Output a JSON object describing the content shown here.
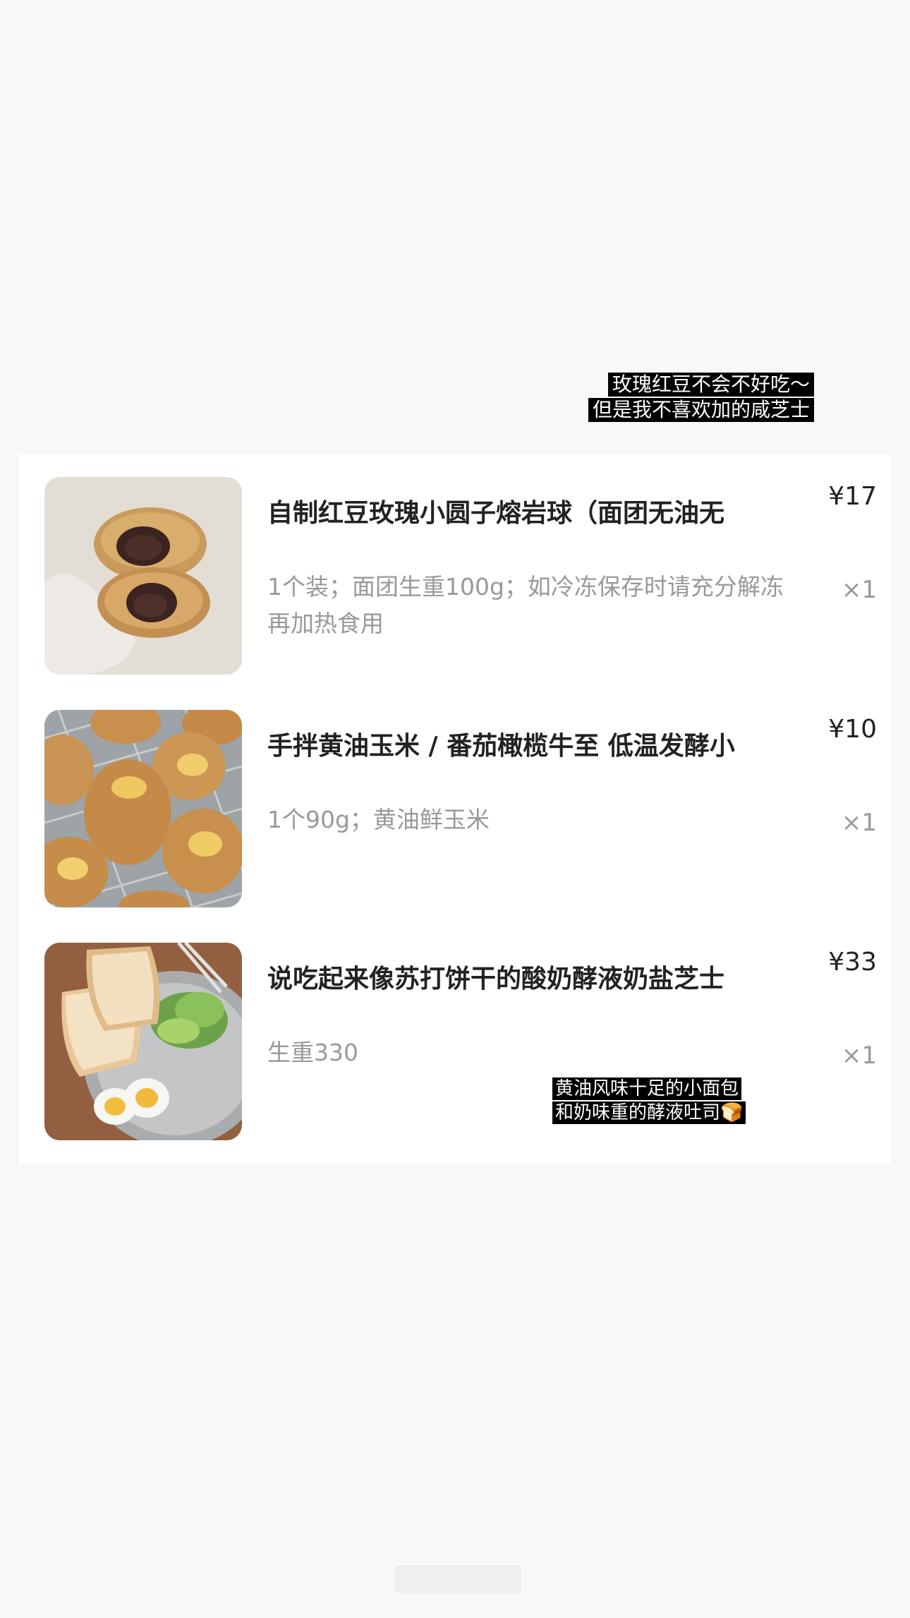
{
  "top_caption": {
    "line1": "玫瑰红豆不会不好吃～",
    "line2": "但是我不喜欢加的咸芝士"
  },
  "items": [
    {
      "title": "自制红豆玫瑰小圆子熔岩球（面团无油无",
      "desc": "1个装；面团生重100g；如冷冻保存时请充分解冻再加热食用",
      "price": "¥17",
      "qty": "×1",
      "image": "red-bean-lava-bun-photo"
    },
    {
      "title": "手拌黄油玉米 / 番茄橄榄牛至 低温发酵小",
      "desc": "1个90g；黄油鲜玉米",
      "price": "¥10",
      "qty": "×1",
      "image": "butter-corn-bun-photo"
    },
    {
      "title": "说吃起来像苏打饼干的酸奶酵液奶盐芝士",
      "desc": "生重330",
      "price": "¥33",
      "qty": "×1",
      "image": "sourdough-toast-plate-photo"
    }
  ],
  "bottom_caption": {
    "line1": "黄油风味十足的小面包",
    "line2": "和奶味重的酵液吐司🍞"
  },
  "colors": {
    "background": "#f8f8f8",
    "card": "#ffffff",
    "title_text": "#222222",
    "secondary_text": "#999999",
    "caption_bg": "#000000",
    "caption_text": "#ffffff"
  }
}
